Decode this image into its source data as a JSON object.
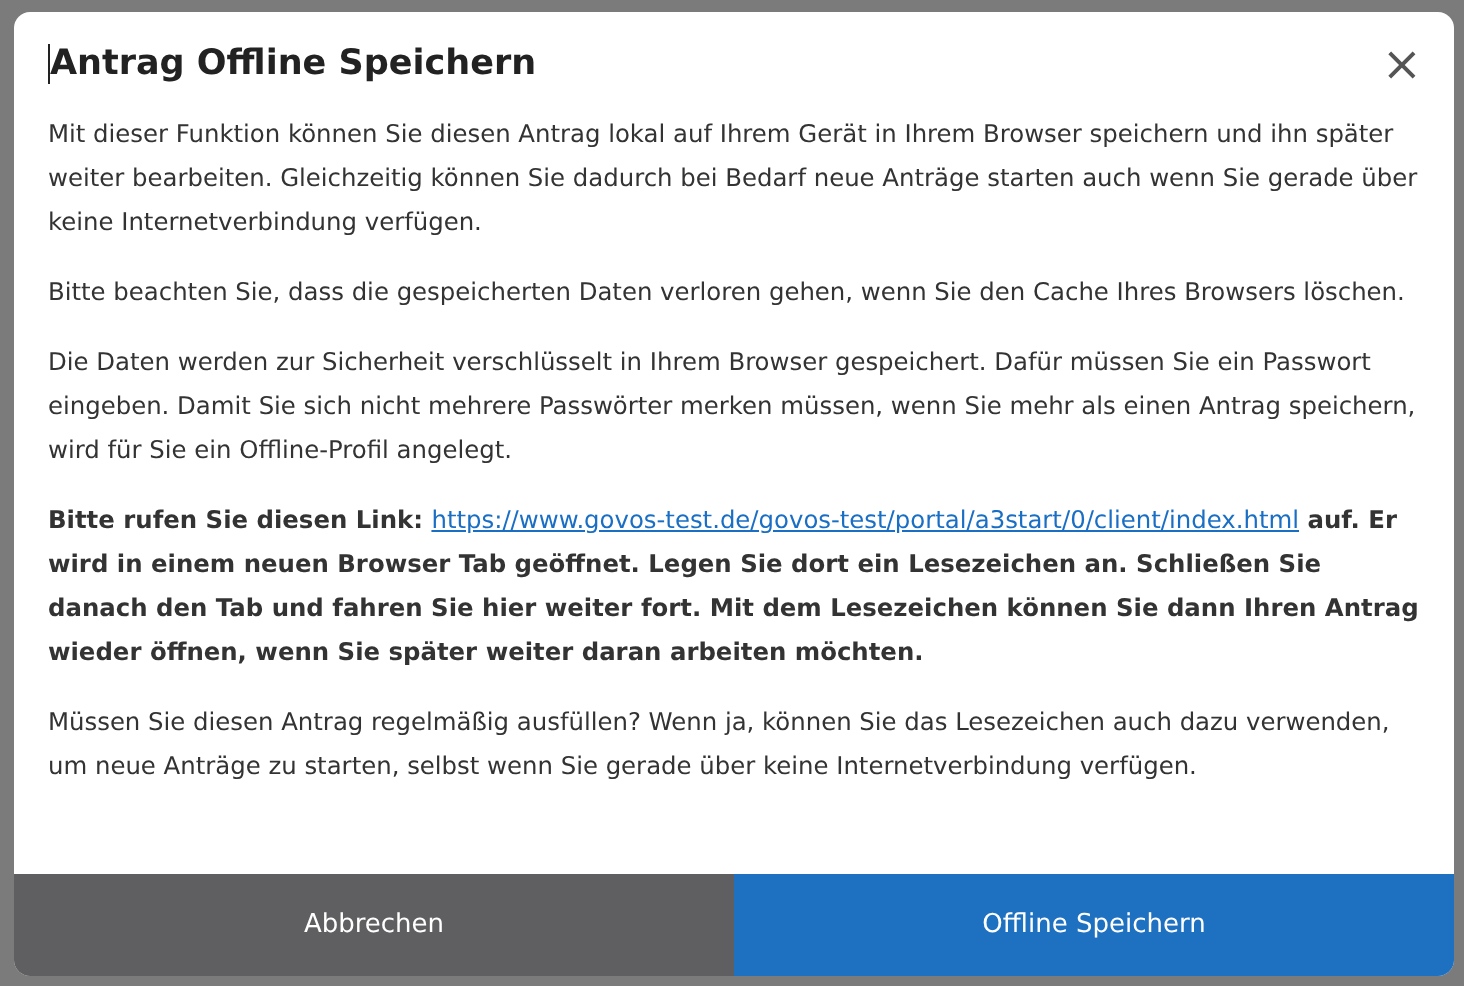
{
  "dialog": {
    "title": "Antrag Offline Speichern",
    "close": "×",
    "paragraphs": [
      {
        "kind": "text",
        "text": "Mit dieser Funktion können Sie diesen Antrag lokal auf Ihrem Gerät in Ihrem Browser speichern und ihn später weiter bearbeiten. Gleichzeitig können Sie dadurch bei Bedarf neue Anträge starten auch wenn Sie gerade über keine Internetverbindung verfügen."
      },
      {
        "kind": "text",
        "text": "Bitte beachten Sie, dass die gespeicherten Daten verloren gehen, wenn Sie den Cache Ihres Browsers löschen."
      },
      {
        "kind": "text",
        "text": "Die Daten werden zur Sicherheit verschlüsselt in Ihrem Browser gespeichert. Dafür müssen Sie ein Passwort eingeben. Damit Sie sich nicht mehrere Passwörter merken müssen, wenn Sie mehr als einen Antrag speichern, wird für Sie ein Offline-Profil angelegt."
      },
      {
        "kind": "link-notice",
        "before": "Bitte rufen Sie diesen Link:",
        "link": "https://www.govos-test.de/govos-test/portal/a3start/0/client/index.html",
        "after": "auf. Er wird in einem neuen Browser Tab geöffnet. Legen Sie dort ein Lesezeichen an. Schließen Sie danach den Tab und fahren Sie hier weiter fort. Mit dem Lesezeichen können Sie dann Ihren Antrag wieder öffnen, wenn Sie später weiter daran arbeiten möchten."
      },
      {
        "kind": "text",
        "text": "Müssen Sie diesen Antrag regelmäßig ausfüllen? Wenn ja, können Sie das Lesezeichen auch dazu verwenden, um neue Anträge zu starten, selbst wenn Sie gerade über keine Internetverbindung verfügen."
      }
    ],
    "buttons": [
      {
        "kind": "secondary",
        "label": "Abbrechen"
      },
      {
        "kind": "primary",
        "label": "Offline Speichern"
      }
    ]
  }
}
